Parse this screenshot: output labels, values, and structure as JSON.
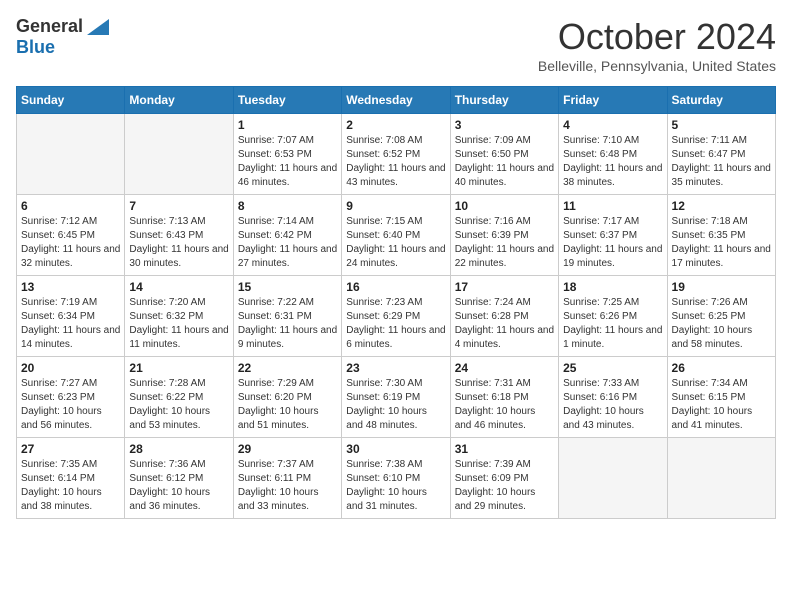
{
  "header": {
    "logo_line1": "General",
    "logo_line2": "Blue",
    "month_title": "October 2024",
    "subtitle": "Belleville, Pennsylvania, United States"
  },
  "weekdays": [
    "Sunday",
    "Monday",
    "Tuesday",
    "Wednesday",
    "Thursday",
    "Friday",
    "Saturday"
  ],
  "weeks": [
    [
      {
        "day": "",
        "info": ""
      },
      {
        "day": "",
        "info": ""
      },
      {
        "day": "1",
        "info": "Sunrise: 7:07 AM\nSunset: 6:53 PM\nDaylight: 11 hours and 46 minutes."
      },
      {
        "day": "2",
        "info": "Sunrise: 7:08 AM\nSunset: 6:52 PM\nDaylight: 11 hours and 43 minutes."
      },
      {
        "day": "3",
        "info": "Sunrise: 7:09 AM\nSunset: 6:50 PM\nDaylight: 11 hours and 40 minutes."
      },
      {
        "day": "4",
        "info": "Sunrise: 7:10 AM\nSunset: 6:48 PM\nDaylight: 11 hours and 38 minutes."
      },
      {
        "day": "5",
        "info": "Sunrise: 7:11 AM\nSunset: 6:47 PM\nDaylight: 11 hours and 35 minutes."
      }
    ],
    [
      {
        "day": "6",
        "info": "Sunrise: 7:12 AM\nSunset: 6:45 PM\nDaylight: 11 hours and 32 minutes."
      },
      {
        "day": "7",
        "info": "Sunrise: 7:13 AM\nSunset: 6:43 PM\nDaylight: 11 hours and 30 minutes."
      },
      {
        "day": "8",
        "info": "Sunrise: 7:14 AM\nSunset: 6:42 PM\nDaylight: 11 hours and 27 minutes."
      },
      {
        "day": "9",
        "info": "Sunrise: 7:15 AM\nSunset: 6:40 PM\nDaylight: 11 hours and 24 minutes."
      },
      {
        "day": "10",
        "info": "Sunrise: 7:16 AM\nSunset: 6:39 PM\nDaylight: 11 hours and 22 minutes."
      },
      {
        "day": "11",
        "info": "Sunrise: 7:17 AM\nSunset: 6:37 PM\nDaylight: 11 hours and 19 minutes."
      },
      {
        "day": "12",
        "info": "Sunrise: 7:18 AM\nSunset: 6:35 PM\nDaylight: 11 hours and 17 minutes."
      }
    ],
    [
      {
        "day": "13",
        "info": "Sunrise: 7:19 AM\nSunset: 6:34 PM\nDaylight: 11 hours and 14 minutes."
      },
      {
        "day": "14",
        "info": "Sunrise: 7:20 AM\nSunset: 6:32 PM\nDaylight: 11 hours and 11 minutes."
      },
      {
        "day": "15",
        "info": "Sunrise: 7:22 AM\nSunset: 6:31 PM\nDaylight: 11 hours and 9 minutes."
      },
      {
        "day": "16",
        "info": "Sunrise: 7:23 AM\nSunset: 6:29 PM\nDaylight: 11 hours and 6 minutes."
      },
      {
        "day": "17",
        "info": "Sunrise: 7:24 AM\nSunset: 6:28 PM\nDaylight: 11 hours and 4 minutes."
      },
      {
        "day": "18",
        "info": "Sunrise: 7:25 AM\nSunset: 6:26 PM\nDaylight: 11 hours and 1 minute."
      },
      {
        "day": "19",
        "info": "Sunrise: 7:26 AM\nSunset: 6:25 PM\nDaylight: 10 hours and 58 minutes."
      }
    ],
    [
      {
        "day": "20",
        "info": "Sunrise: 7:27 AM\nSunset: 6:23 PM\nDaylight: 10 hours and 56 minutes."
      },
      {
        "day": "21",
        "info": "Sunrise: 7:28 AM\nSunset: 6:22 PM\nDaylight: 10 hours and 53 minutes."
      },
      {
        "day": "22",
        "info": "Sunrise: 7:29 AM\nSunset: 6:20 PM\nDaylight: 10 hours and 51 minutes."
      },
      {
        "day": "23",
        "info": "Sunrise: 7:30 AM\nSunset: 6:19 PM\nDaylight: 10 hours and 48 minutes."
      },
      {
        "day": "24",
        "info": "Sunrise: 7:31 AM\nSunset: 6:18 PM\nDaylight: 10 hours and 46 minutes."
      },
      {
        "day": "25",
        "info": "Sunrise: 7:33 AM\nSunset: 6:16 PM\nDaylight: 10 hours and 43 minutes."
      },
      {
        "day": "26",
        "info": "Sunrise: 7:34 AM\nSunset: 6:15 PM\nDaylight: 10 hours and 41 minutes."
      }
    ],
    [
      {
        "day": "27",
        "info": "Sunrise: 7:35 AM\nSunset: 6:14 PM\nDaylight: 10 hours and 38 minutes."
      },
      {
        "day": "28",
        "info": "Sunrise: 7:36 AM\nSunset: 6:12 PM\nDaylight: 10 hours and 36 minutes."
      },
      {
        "day": "29",
        "info": "Sunrise: 7:37 AM\nSunset: 6:11 PM\nDaylight: 10 hours and 33 minutes."
      },
      {
        "day": "30",
        "info": "Sunrise: 7:38 AM\nSunset: 6:10 PM\nDaylight: 10 hours and 31 minutes."
      },
      {
        "day": "31",
        "info": "Sunrise: 7:39 AM\nSunset: 6:09 PM\nDaylight: 10 hours and 29 minutes."
      },
      {
        "day": "",
        "info": ""
      },
      {
        "day": "",
        "info": ""
      }
    ]
  ]
}
